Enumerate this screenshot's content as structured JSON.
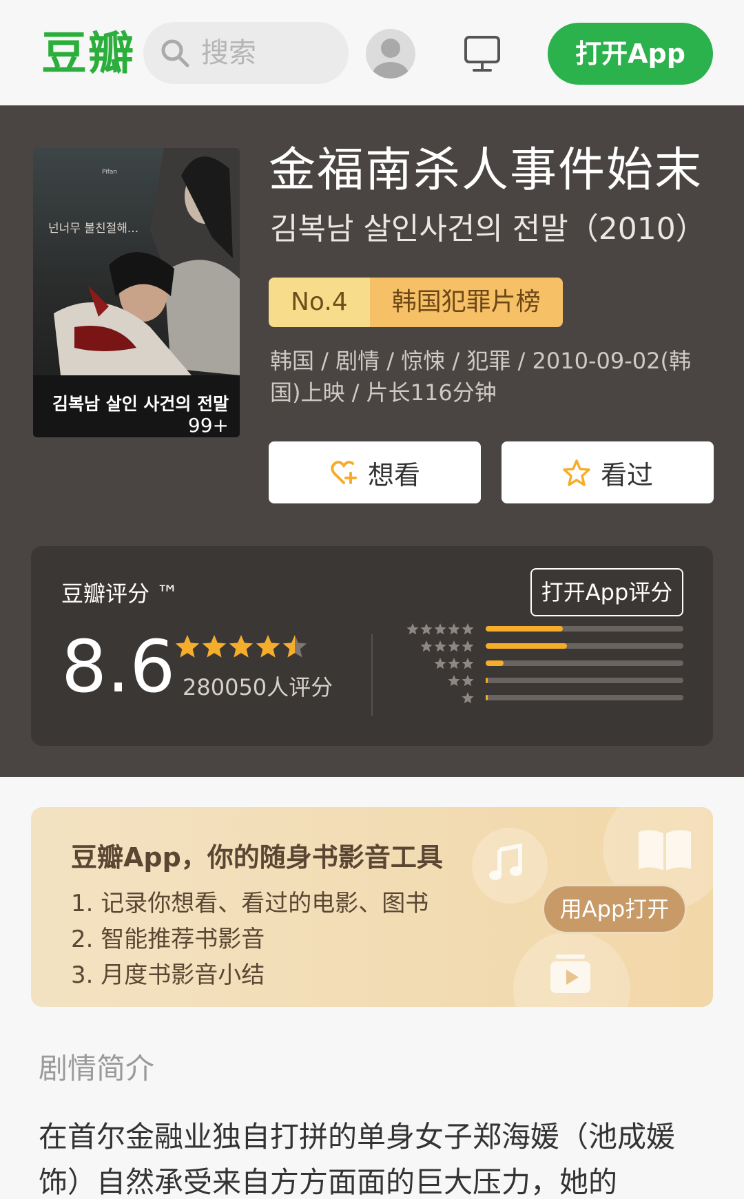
{
  "header": {
    "logo": "豆瓣",
    "search_placeholder": "搜索",
    "open_app_label": "打开App"
  },
  "movie": {
    "title": "金福南杀人事件始末",
    "original_title": "김복남 살인사건의 전말（2010）",
    "rank_no": "No.4",
    "rank_category": "韩国犯罪片榜",
    "meta": "韩国 / 剧情 / 惊悚 / 犯罪 / 2010-09-02(韩国)上映 / 片长116分钟",
    "want_label": "想看",
    "seen_label": "看过",
    "poster": {
      "tagline": "넌너무 불친절해...",
      "title_kr": "김복남 살인 사건의 전말",
      "rating_mark": "99+"
    }
  },
  "rating": {
    "label": "豆瓣评分 ™",
    "score": "8.6",
    "stars_value": 4.5,
    "count": "280050人评分",
    "rate_button": "打开App评分",
    "distribution": [
      0.39,
      0.41,
      0.09,
      0.01,
      0.01
    ]
  },
  "promo": {
    "title": "豆瓣App，你的随身书影音工具",
    "items": [
      "1. 记录你想看、看过的电影、图书",
      "2. 智能推荐书影音",
      "3. 月度书影音小结"
    ],
    "button": "用App打开"
  },
  "synopsis": {
    "title": "剧情简介",
    "text": "在首尔金融业独自打拼的单身女子郑海媛（池成媛 饰）自然承受来自方方面面的巨大压力，她的"
  },
  "colors": {
    "brand_green": "#2bb24c",
    "hero_bg": "#4a4542",
    "star": "#f6ad2c"
  }
}
